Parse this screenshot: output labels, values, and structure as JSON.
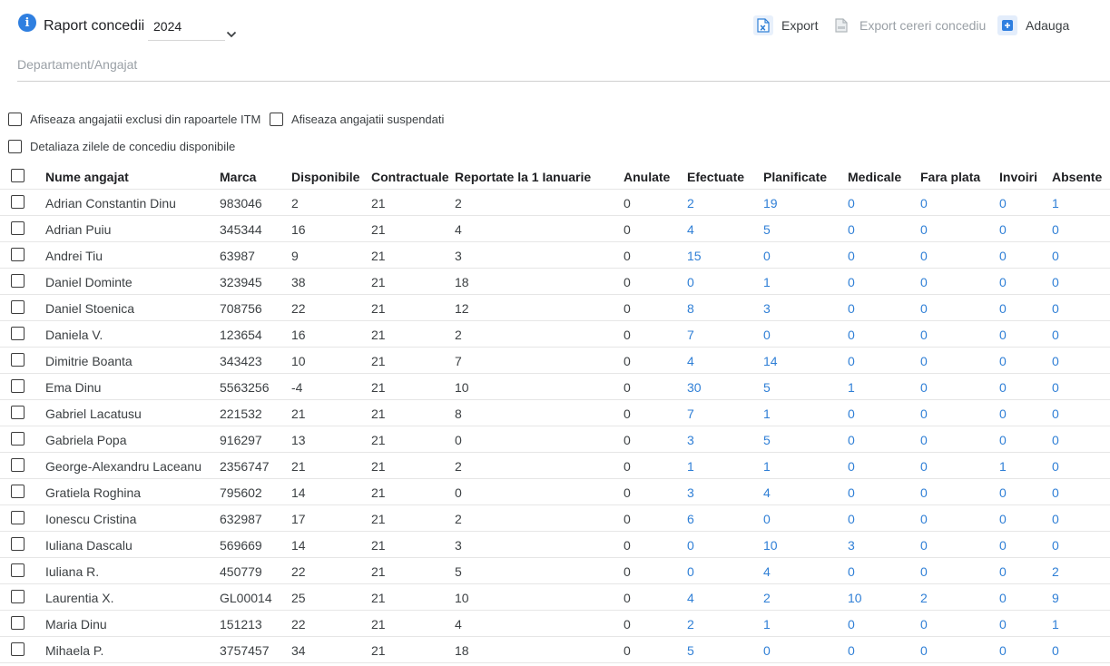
{
  "header": {
    "title": "Raport concedii",
    "year": "2024",
    "icons": {
      "info": "info-icon",
      "year_chevron": "chevron-down-icon"
    }
  },
  "toolbar": {
    "export_label": "Export",
    "export_icon": "excel-file-icon",
    "export_requests_label": "Export cereri concediu",
    "export_requests_icon": "pdf-file-icon",
    "add_label": "Adauga",
    "add_icon": "plus-icon"
  },
  "search": {
    "placeholder": "Departament/Angajat",
    "value": ""
  },
  "filters": {
    "excluded_itm": "Afiseaza angajatii exclusi din rapoartele ITM",
    "suspended": "Afiseaza angajatii suspendati",
    "detail_days": "Detaliaza zilele de concediu disponibile"
  },
  "colors": {
    "accent": "#2f7fd6",
    "info_icon": "#2f7fe0",
    "text": "#3c4043",
    "muted": "#9aa0a6"
  },
  "table": {
    "columns": [
      "Nume angajat",
      "Marca",
      "Disponibile",
      "Contractuale",
      "Reportate la 1 Ianuarie",
      "Anulate",
      "Efectuate",
      "Planificate",
      "Medicale",
      "Fara plata",
      "Invoiri",
      "Absente"
    ],
    "rows": [
      [
        "Adrian Constantin Dinu",
        "983046",
        "2",
        "21",
        "2",
        "0",
        "2",
        "19",
        "0",
        "0",
        "0",
        "1"
      ],
      [
        "Adrian Puiu",
        "345344",
        "16",
        "21",
        "4",
        "0",
        "4",
        "5",
        "0",
        "0",
        "0",
        "0"
      ],
      [
        "Andrei Tiu",
        "63987",
        "9",
        "21",
        "3",
        "0",
        "15",
        "0",
        "0",
        "0",
        "0",
        "0"
      ],
      [
        "Daniel Dominte",
        "323945",
        "38",
        "21",
        "18",
        "0",
        "0",
        "1",
        "0",
        "0",
        "0",
        "0"
      ],
      [
        "Daniel Stoenica",
        "708756",
        "22",
        "21",
        "12",
        "0",
        "8",
        "3",
        "0",
        "0",
        "0",
        "0"
      ],
      [
        "Daniela V.",
        "123654",
        "16",
        "21",
        "2",
        "0",
        "7",
        "0",
        "0",
        "0",
        "0",
        "0"
      ],
      [
        "Dimitrie Boanta",
        "343423",
        "10",
        "21",
        "7",
        "0",
        "4",
        "14",
        "0",
        "0",
        "0",
        "0"
      ],
      [
        "Ema Dinu",
        "5563256",
        "-4",
        "21",
        "10",
        "0",
        "30",
        "5",
        "1",
        "0",
        "0",
        "0"
      ],
      [
        "Gabriel Lacatusu",
        "221532",
        "21",
        "21",
        "8",
        "0",
        "7",
        "1",
        "0",
        "0",
        "0",
        "0"
      ],
      [
        "Gabriela Popa",
        "916297",
        "13",
        "21",
        "0",
        "0",
        "3",
        "5",
        "0",
        "0",
        "0",
        "0"
      ],
      [
        "George-Alexandru Laceanu",
        "2356747",
        "21",
        "21",
        "2",
        "0",
        "1",
        "1",
        "0",
        "0",
        "1",
        "0"
      ],
      [
        "Gratiela Roghina",
        "795602",
        "14",
        "21",
        "0",
        "0",
        "3",
        "4",
        "0",
        "0",
        "0",
        "0"
      ],
      [
        "Ionescu Cristina",
        "632987",
        "17",
        "21",
        "2",
        "0",
        "6",
        "0",
        "0",
        "0",
        "0",
        "0"
      ],
      [
        "Iuliana Dascalu",
        "569669",
        "14",
        "21",
        "3",
        "0",
        "0",
        "10",
        "3",
        "0",
        "0",
        "0"
      ],
      [
        "Iuliana R.",
        "450779",
        "22",
        "21",
        "5",
        "0",
        "0",
        "4",
        "0",
        "0",
        "0",
        "2"
      ],
      [
        "Laurentia X.",
        "GL00014",
        "25",
        "21",
        "10",
        "0",
        "4",
        "2",
        "10",
        "2",
        "0",
        "9"
      ],
      [
        "Maria Dinu",
        "151213",
        "22",
        "21",
        "4",
        "0",
        "2",
        "1",
        "0",
        "0",
        "0",
        "1"
      ],
      [
        "Mihaela P.",
        "3757457",
        "34",
        "21",
        "18",
        "0",
        "5",
        "0",
        "0",
        "0",
        "0",
        "0"
      ]
    ]
  }
}
